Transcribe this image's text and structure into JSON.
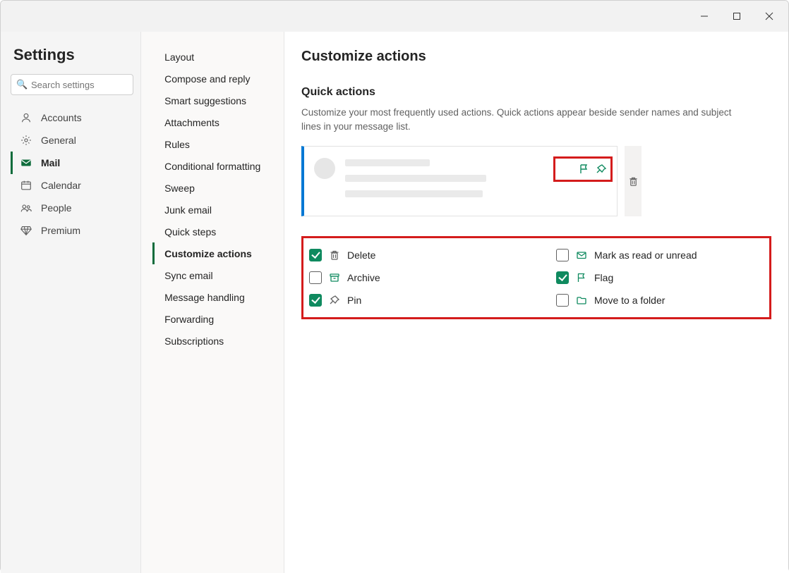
{
  "header": {
    "title": "Settings"
  },
  "search": {
    "placeholder": "Search settings"
  },
  "nav": {
    "items": [
      {
        "label": "Accounts",
        "key": "accounts"
      },
      {
        "label": "General",
        "key": "general"
      },
      {
        "label": "Mail",
        "key": "mail",
        "active": true
      },
      {
        "label": "Calendar",
        "key": "calendar"
      },
      {
        "label": "People",
        "key": "people"
      },
      {
        "label": "Premium",
        "key": "premium"
      }
    ]
  },
  "subnav": {
    "items": [
      {
        "label": "Layout"
      },
      {
        "label": "Compose and reply"
      },
      {
        "label": "Smart suggestions"
      },
      {
        "label": "Attachments"
      },
      {
        "label": "Rules"
      },
      {
        "label": "Conditional formatting"
      },
      {
        "label": "Sweep"
      },
      {
        "label": "Junk email"
      },
      {
        "label": "Quick steps"
      },
      {
        "label": "Customize actions",
        "active": true
      },
      {
        "label": "Sync email"
      },
      {
        "label": "Message handling"
      },
      {
        "label": "Forwarding"
      },
      {
        "label": "Subscriptions"
      }
    ]
  },
  "main": {
    "title": "Customize actions",
    "section_title": "Quick actions",
    "section_desc": "Customize your most frequently used actions. Quick actions appear beside sender names and subject lines in your message list."
  },
  "actions": {
    "left": [
      {
        "label": "Delete",
        "icon": "trash",
        "checked": true
      },
      {
        "label": "Archive",
        "icon": "archive",
        "checked": false
      },
      {
        "label": "Pin",
        "icon": "pin",
        "checked": true
      }
    ],
    "right": [
      {
        "label": "Mark as read or unread",
        "icon": "mail",
        "checked": false
      },
      {
        "label": "Flag",
        "icon": "flag",
        "checked": true
      },
      {
        "label": "Move to a folder",
        "icon": "folder",
        "checked": false
      }
    ]
  }
}
